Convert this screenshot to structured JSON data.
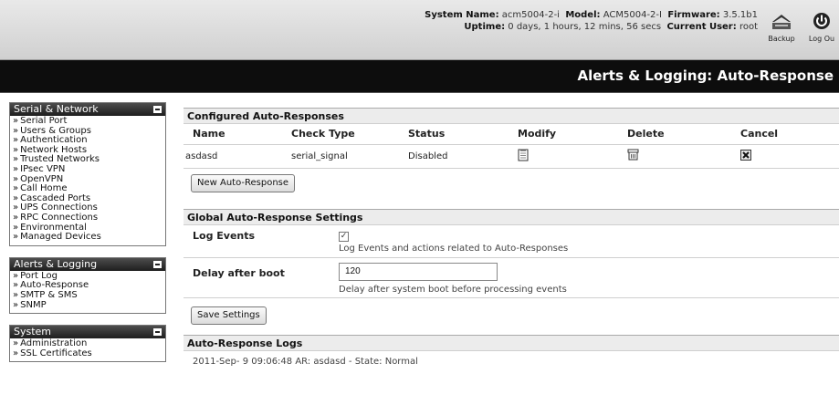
{
  "header": {
    "system_name_label": "System Name:",
    "system_name": "acm5004-2-i",
    "model_label": "Model:",
    "model": "ACM5004-2-I",
    "firmware_label": "Firmware:",
    "firmware": "3.5.1b1",
    "uptime_label": "Uptime:",
    "uptime": "0 days, 1 hours, 12 mins, 56 secs",
    "current_user_label": "Current User:",
    "current_user": "root",
    "backup_label": "Backup",
    "logout_label": "Log Ou",
    "backup_icon": "backup-icon",
    "logout_icon": "power-icon"
  },
  "page_title": "Alerts & Logging: Auto-Response",
  "sidebar": {
    "sections": [
      {
        "title": "Serial & Network",
        "items": [
          "Serial Port",
          "Users & Groups",
          "Authentication",
          "Network Hosts",
          "Trusted Networks",
          "IPsec VPN",
          "OpenVPN",
          "Call Home",
          "Cascaded Ports",
          "UPS Connections",
          "RPC Connections",
          "Environmental",
          "Managed Devices"
        ]
      },
      {
        "title": "Alerts & Logging",
        "items": [
          "Port Log",
          "Auto-Response",
          "SMTP & SMS",
          "SNMP"
        ]
      },
      {
        "title": "System",
        "items": [
          "Administration",
          "SSL Certificates"
        ]
      }
    ]
  },
  "configured": {
    "heading": "Configured Auto-Responses",
    "columns": [
      "Name",
      "Check Type",
      "Status",
      "Modify",
      "Delete",
      "Cancel"
    ],
    "rows": [
      {
        "name": "asdasd",
        "check_type": "serial_signal",
        "status": "Disabled",
        "modify_icon": "edit-icon",
        "delete_icon": "trash-icon",
        "cancel_icon": "cancel-icon"
      }
    ],
    "new_button": "New Auto-Response"
  },
  "global": {
    "heading": "Global Auto-Response Settings",
    "log_events_label": "Log Events",
    "log_events_checked": true,
    "log_events_hint": "Log Events and actions related to Auto-Responses",
    "delay_label": "Delay after boot",
    "delay_value": "120",
    "delay_hint": "Delay after system boot before processing events",
    "save_button": "Save Settings"
  },
  "logs": {
    "heading": "Auto-Response Logs",
    "entries": [
      "2011-Sep- 9 09:06:48 AR: asdasd - State: Normal"
    ]
  },
  "colors": {
    "title_bar": "#0d0d0d",
    "sidebar_header": "#2a2a2a",
    "section_header": "#ececec"
  }
}
